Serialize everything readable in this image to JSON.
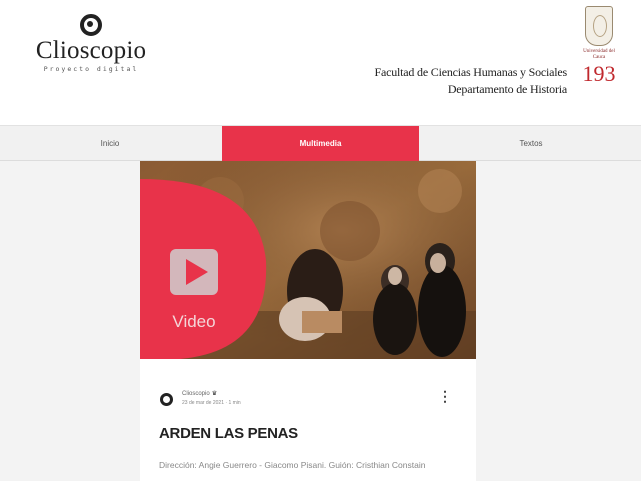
{
  "header": {
    "logo": {
      "name": "Clioscopio",
      "tagline": "Proyecto digital"
    },
    "faculty_line1": "Facultad de Ciencias Humanas y Sociales",
    "faculty_line2": "Departamento de Historia",
    "university": {
      "name": "Universidad del Cauca",
      "years": "193"
    }
  },
  "nav": {
    "items": [
      {
        "label": "Inicio"
      },
      {
        "label": "Multimedia"
      },
      {
        "label": "Textos"
      }
    ],
    "active_index": 1
  },
  "post": {
    "overlay_label": "Video",
    "author": "Clioscopio",
    "date": "23 de mar de 2021",
    "read_time": "1 min",
    "title": "ARDEN LAS PENAS",
    "excerpt": "Dirección: Angie Guerrero - Giacomo Pisani. Guión: Cristhian Constain"
  },
  "icons": {
    "logo": "clioscopio-logo-icon",
    "play": "play-icon",
    "author_badge": "crown-icon",
    "more": "more-options-icon"
  },
  "colors": {
    "accent": "#e8334a",
    "nav_bg": "#f1f1f1",
    "content_bg": "#f3f3f3",
    "title": "#222222"
  }
}
